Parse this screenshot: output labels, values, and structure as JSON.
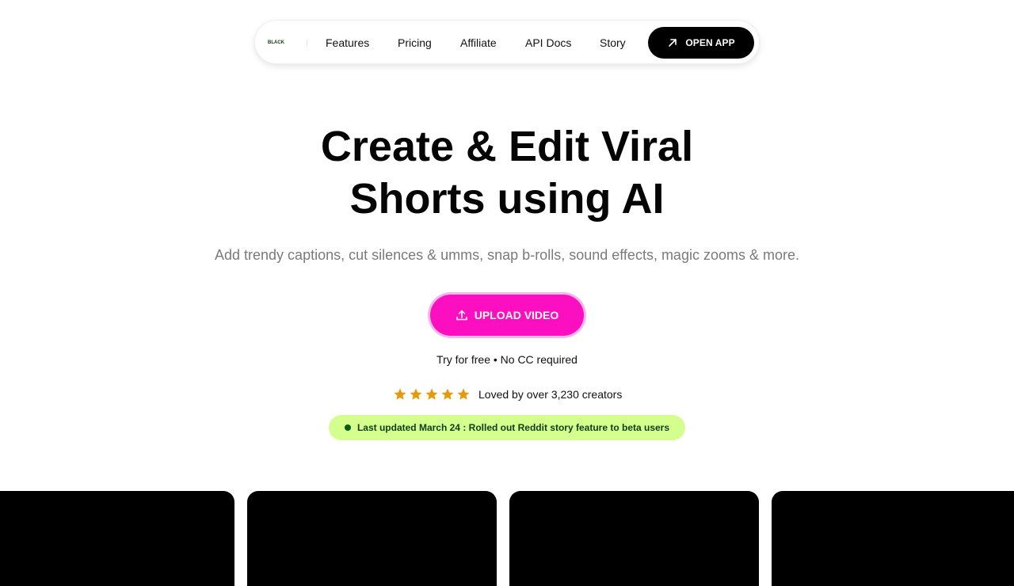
{
  "nav": {
    "logo": "BLACK",
    "links": [
      "Features",
      "Pricing",
      "Affiliate",
      "API Docs",
      "Story"
    ],
    "open_app": "OPEN APP"
  },
  "hero": {
    "title_line1": "Create & Edit Viral",
    "title_line2": "Shorts using AI",
    "subtitle": "Add trendy captions, cut silences & umms, snap b-rolls, sound effects, magic zooms & more.",
    "upload_button": "UPLOAD VIDEO",
    "free_note": "Try for free • No CC required",
    "rating_stars": 5,
    "rating_text": "Loved by over 3,230 creators",
    "update_text": "Last updated March 24 : Rolled out Reddit story feature to beta users"
  },
  "colors": {
    "accent": "#fc0fc0",
    "star": "#e59a0c",
    "update_bg": "#d4ff8f",
    "update_text": "#0f3d10"
  },
  "icons": {
    "open_app": "arrow-up-right-icon",
    "upload": "upload-icon",
    "rating": "star-icon",
    "status": "dot-icon"
  }
}
